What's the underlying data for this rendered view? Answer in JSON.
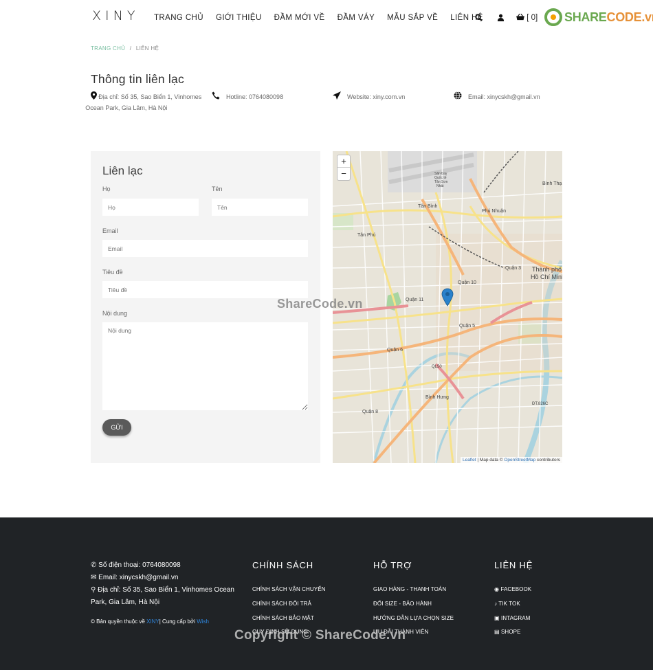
{
  "nav": {
    "logo": "XINY",
    "items": [
      "TRANG CHỦ",
      "GIỚI THIỆU",
      "ĐẦM MỚI VỀ",
      "ĐẦM VÁY",
      "MẪU SẮP VỀ",
      "LIÊN HỆ"
    ],
    "cart": "[ 0]"
  },
  "watermark_logo": {
    "share": "SHARE",
    "code": "CODE.vn"
  },
  "breadcrumb": {
    "home": "TRANG CHỦ",
    "sep": "/",
    "current": "LIÊN HỆ"
  },
  "contact_info": {
    "title": "Thông tin liên lạc",
    "address": "Địa chỉ: Số 35, Sao Biển 1, Vinhomes Ocean Park, Gia Lâm, Hà Nội",
    "hotline": "Hotline: 0764080098",
    "website": "Website: xiny.com.vn",
    "email": "Email: xinycskh@gmail.vn"
  },
  "form": {
    "title": "Liên lạc",
    "last_name_label": "Họ",
    "last_name_placeholder": "Họ",
    "first_name_label": "Tên",
    "first_name_placeholder": "Tên",
    "email_label": "Email",
    "email_placeholder": "Email",
    "subject_label": "Tiêu đề",
    "subject_placeholder": "Tiêu đề",
    "message_label": "Nội dung",
    "message_placeholder": "Nội dung",
    "submit": "GỬI"
  },
  "map": {
    "zoom_in": "+",
    "zoom_out": "−",
    "attr_leaflet": "Leaflet",
    "attr_mid": " | Map data © ",
    "attr_osm": "OpenStreetMap",
    "attr_end": " contributors",
    "labels": {
      "tanbinh": "Tân Bình",
      "phunhuan": "Phú Nhuận",
      "tanphu": "Tân Phú",
      "quan3": "Quận 3",
      "tphcm1": "Thành phố",
      "tphcm2": "Hồ Chí Minh",
      "quan10": "Quận 10",
      "quan11": "Quận 11",
      "quan5": "Quận 5",
      "quan6": "Quận 6",
      "quan8": "Quận 8",
      "binhhung": "Bình Hưng",
      "binhthanh": "Bình Thạ",
      "ql50": "QL50",
      "dt826c": "ĐT.826C",
      "airport1": "Sân bay",
      "airport2": "Quốc tế",
      "airport3": "Tân Sơn",
      "airport4": "Nhất"
    }
  },
  "footer": {
    "phone": "Số điện thoại: 0764080098",
    "email": "Email: xinycskh@gmail.vn",
    "address": "Địa chỉ: Số 35, Sao Biển 1, Vinhomes Ocean Park, Gia Lâm, Hà Nội",
    "copy_pre": "© Bản quyền thuộc về ",
    "copy_brand": "XINY",
    "copy_mid": "| Cung cấp bởi ",
    "copy_provider": "Wish",
    "policy": {
      "title": "CHÍNH SÁCH",
      "items": [
        "CHÍNH SÁCH VẬN CHUYỂN",
        "CHÍNH SÁCH ĐỔI TRẢ",
        "CHÍNH SÁCH BẢO MẬT",
        "QUY ĐỊNH SỬ DỤNG"
      ]
    },
    "support": {
      "title": "HỖ TRỢ",
      "items": [
        "GIAO HÀNG - THANH TOÁN",
        "ĐỔI SIZE - BẢO HÀNH",
        "HƯỚNG DẪN LỰA CHỌN SIZE",
        "ƯU ĐÃI THÀNH VIÊN"
      ]
    },
    "contact": {
      "title": "LIÊN HỆ",
      "items": [
        "FACEBOOK",
        "TIK TOK",
        "INTAGRAM",
        "SHOPE"
      ]
    }
  },
  "watermarks": {
    "center": "ShareCode.vn",
    "bottom": "Copyright © ShareCode.vn"
  }
}
